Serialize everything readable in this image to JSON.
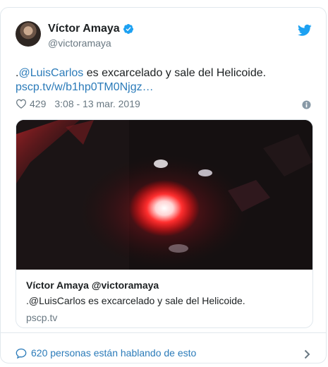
{
  "author": {
    "name": "Víctor Amaya",
    "handle": "@victoramaya"
  },
  "tweet": {
    "text_prefix": ".",
    "mention": "@LuisCarlos",
    "text_rest": " es excarcelado y sale del Helicoide.",
    "link": "pscp.tv/w/b1hp0TM0Njgz…"
  },
  "meta": {
    "likes": "429",
    "timestamp": "3:08 - 13 mar. 2019"
  },
  "media_card": {
    "title": "Víctor Amaya @victoramaya",
    "description": ".@LuisCarlos es excarcelado y sale del Helicoide.",
    "domain": "pscp.tv"
  },
  "footer": {
    "conversation": "620 personas están hablando de esto"
  },
  "colors": {
    "link": "#2b7bb9",
    "verified": "#1da1f2",
    "muted": "#697882"
  }
}
